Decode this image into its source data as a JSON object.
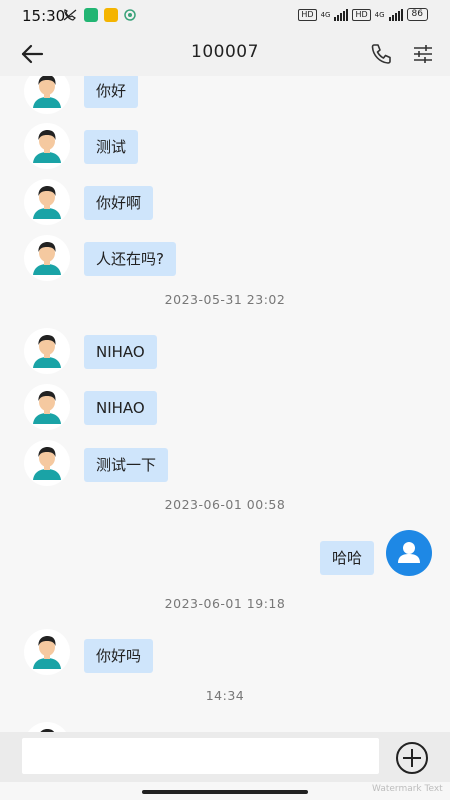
{
  "status_bar": {
    "time": "15:30",
    "network_1": "4G",
    "network_2": "4G",
    "hd_1": "HD",
    "hd_2": "HD",
    "battery": "86"
  },
  "header": {
    "title": "100007"
  },
  "messages": [
    {
      "side": "left",
      "text": "你好"
    },
    {
      "side": "left",
      "text": "测试"
    },
    {
      "side": "left",
      "text": "你好啊"
    },
    {
      "side": "left",
      "text": "人还在吗?"
    },
    {
      "timestamp": "2023-05-31 23:02"
    },
    {
      "side": "left",
      "text": "NIHAO"
    },
    {
      "side": "left",
      "text": "NIHAO"
    },
    {
      "side": "left",
      "text": "测试一下"
    },
    {
      "timestamp": "2023-06-01 00:58"
    },
    {
      "side": "right",
      "text": "哈哈"
    },
    {
      "timestamp": "2023-06-01 19:18"
    },
    {
      "side": "left",
      "text": "你好吗"
    },
    {
      "timestamp": "14:34"
    }
  ],
  "input": {
    "value": "",
    "placeholder": ""
  },
  "watermark": "Watermark Text",
  "colors": {
    "bubble": "#cfe5fb",
    "self_avatar": "#1e88e5",
    "background": "#f7f7f7"
  }
}
